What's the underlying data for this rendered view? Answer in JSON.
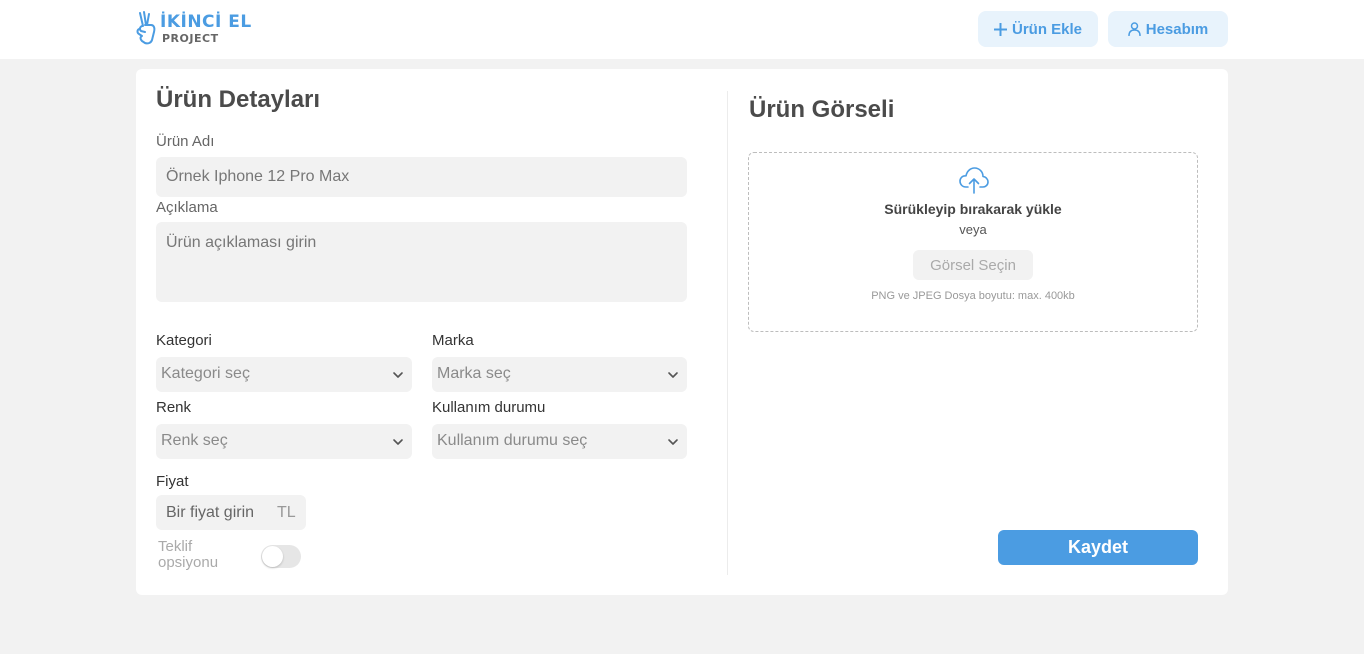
{
  "header": {
    "logo": {
      "title": "İKİNCİ EL",
      "subtitle": "PROJECT",
      "icon": "hand-peace-icon"
    },
    "add_product_label": "Ürün Ekle",
    "add_product_icon": "plus-icon",
    "account_label": "Hesabım",
    "account_icon": "user-icon"
  },
  "details": {
    "title": "Ürün Detayları",
    "name_label": "Ürün Adı",
    "name_placeholder": "Örnek Iphone 12 Pro Max",
    "description_label": "Açıklama",
    "description_placeholder": "Ürün açıklaması girin",
    "category_label": "Kategori",
    "category_placeholder": "Kategori seç",
    "brand_label": "Marka",
    "brand_placeholder": "Marka seç",
    "color_label": "Renk",
    "color_placeholder": "Renk seç",
    "condition_label": "Kullanım durumu",
    "condition_placeholder": "Kullanım durumu seç",
    "price_label": "Fiyat",
    "price_placeholder": "Bir fiyat girin",
    "price_currency": "TL",
    "offer_label": "Teklif opsiyonu",
    "offer_enabled": false
  },
  "image": {
    "title": "Ürün Görseli",
    "upload_icon": "cloud-upload-icon",
    "drag_text": "Sürükleyip bırakarak yükle",
    "or_text": "veya",
    "select_button": "Görsel Seçin",
    "note": "PNG ve JPEG Dosya boyutu: max. 400kb"
  },
  "save_label": "Kaydet",
  "colors": {
    "accent": "#4b9ce2",
    "accent_light": "#e8f3fc",
    "background": "#f2f2f2",
    "card": "#ffffff"
  }
}
